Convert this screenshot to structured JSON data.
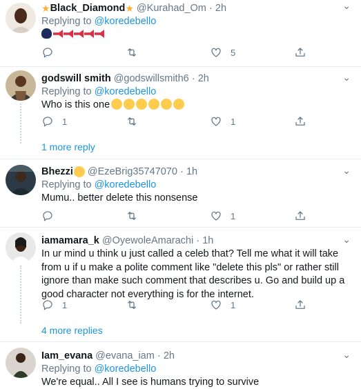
{
  "tweets": [
    {
      "name": "Black_Diamond",
      "handle": "@Kurahad_Om",
      "time": "2h",
      "replying_label": "Replying to",
      "mention": "@koredebello",
      "text": "",
      "reply_count": "",
      "retweet_count": "",
      "like_count": "5"
    },
    {
      "name": "godswill smith",
      "handle": "@godswillsmith6",
      "time": "2h",
      "replying_label": "Replying to",
      "mention": "@koredebello",
      "text": "Who is this one",
      "reply_count": "1",
      "retweet_count": "",
      "like_count": "1"
    },
    {
      "name": "Bhezzi",
      "handle": "@EzeBrig35747070",
      "time": "1h",
      "replying_label": "Replying to",
      "mention": "@koredebello",
      "text": "Mumu.. better delete this nonsense",
      "reply_count": "",
      "retweet_count": "",
      "like_count": "1"
    },
    {
      "name": "iamamara_k",
      "handle": "@OyewoleAmarachi",
      "time": "1h",
      "replying_label": "",
      "mention": "",
      "text": "In ur mind u think u just called a celeb that? Tell me what it will take from u if u make a polite comment like \"delete this pls\" or rather still ignore than make such comment that describes u. Go and build up a good character not everything is for the internet.",
      "reply_count": "1",
      "retweet_count": "",
      "like_count": "1"
    },
    {
      "name": "Iam_evana",
      "handle": "@evana_iam",
      "time": "2h",
      "replying_label": "Replying to",
      "mention": "@koredebello",
      "text": "We're equal.. All I see is humans trying to survive",
      "reply_count": "",
      "retweet_count": "",
      "like_count": ""
    }
  ],
  "thread_links": {
    "one_more_reply": "1 more reply",
    "four_more_replies": "4 more replies"
  },
  "separator": "·",
  "more_glyph": "⌄",
  "colors": {
    "link": "#1b95e0",
    "muted": "#657786",
    "text": "#14171a",
    "border": "#e6ecf0"
  },
  "icons": [
    "reply-icon",
    "retweet-icon",
    "like-icon",
    "share-icon",
    "more-icon"
  ]
}
